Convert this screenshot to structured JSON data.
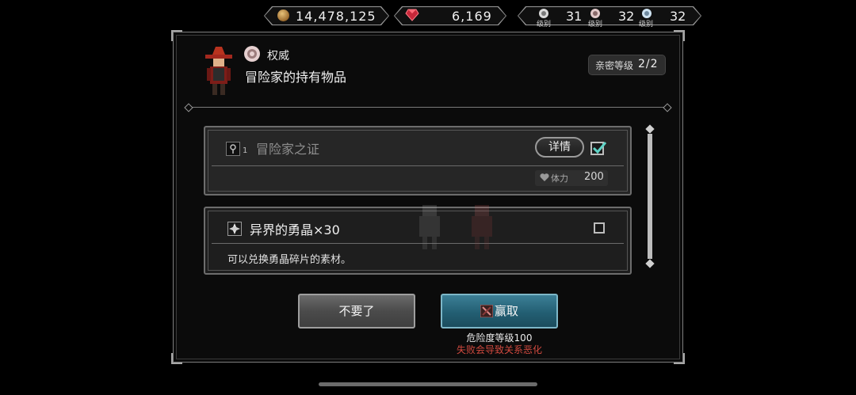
{
  "currency": {
    "gold": "14,478,125",
    "gems": "6,169"
  },
  "ranks": [
    {
      "label": "级别",
      "value": "31"
    },
    {
      "label": "级别",
      "value": "32"
    },
    {
      "label": "级别",
      "value": "32"
    }
  ],
  "header": {
    "authority_label": "权威",
    "title": "冒险家的持有物品",
    "intimacy_label": "亲密等级",
    "intimacy_value": "2/2"
  },
  "items": [
    {
      "name": "冒险家之证",
      "quantity": "1",
      "detail_label": "详情",
      "checked": true,
      "stamina_label": "体力",
      "stamina_value": "200"
    },
    {
      "name": "异界的勇晶×30",
      "checked": false,
      "description": "可以兑换勇晶碎片的素材。"
    }
  ],
  "actions": {
    "decline_label": "不要了",
    "accept_label": "赢取",
    "danger_level": "危险度等级100",
    "fail_warning": "失败会导致关系恶化"
  },
  "colors": {
    "accent_teal": "#235f73",
    "warning_red": "#d24a3f",
    "check_teal": "#5fd3c6"
  }
}
